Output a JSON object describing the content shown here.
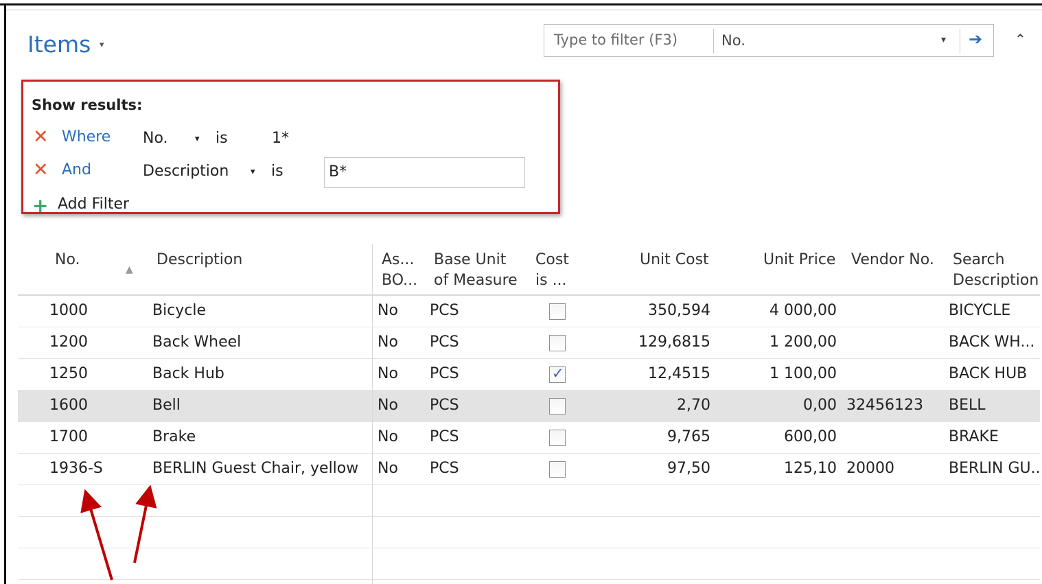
{
  "page": {
    "title": "Items",
    "title_caret": "▾",
    "collapse_icon": "⌃"
  },
  "filter_bar": {
    "placeholder": "Type to filter (F3)",
    "field": "No.",
    "dropdown_icon": "▾",
    "go_icon": "➔"
  },
  "show_results": {
    "title": "Show results:",
    "rows": [
      {
        "remove_icon": "✕",
        "keyword": "Where",
        "field": "No.",
        "caret": "▾",
        "operator": "is",
        "value": "1*"
      },
      {
        "remove_icon": "✕",
        "keyword": "And",
        "field": "Description",
        "caret": "▾",
        "operator": "is",
        "value": "B*"
      }
    ],
    "add_icon": "+",
    "add_label": "Add Filter"
  },
  "table": {
    "sort_icon": "▲",
    "headers": {
      "no": "No.",
      "description": "Description",
      "assembly_bom_1": "As...",
      "assembly_bom_2": "BO...",
      "base_unit_1": "Base Unit",
      "base_unit_2": "of Measure",
      "cost_1": "Cost",
      "cost_2": "is ...",
      "unit_cost": "Unit Cost",
      "unit_price": "Unit Price",
      "vendor_no": "Vendor No.",
      "search_1": "Search",
      "search_2": "Description"
    },
    "rows": [
      {
        "no": "1000",
        "description": "Bicycle",
        "bom": "No",
        "uom": "PCS",
        "cost_adjusted": false,
        "unit_cost": "350,594",
        "unit_price": "4 000,00",
        "vendor_no": "",
        "search": "BICYCLE"
      },
      {
        "no": "1200",
        "description": "Back Wheel",
        "bom": "No",
        "uom": "PCS",
        "cost_adjusted": false,
        "unit_cost": "129,6815",
        "unit_price": "1 200,00",
        "vendor_no": "",
        "search": "BACK WH..."
      },
      {
        "no": "1250",
        "description": "Back Hub",
        "bom": "No",
        "uom": "PCS",
        "cost_adjusted": true,
        "unit_cost": "12,4515",
        "unit_price": "1 100,00",
        "vendor_no": "",
        "search": "BACK HUB"
      },
      {
        "no": "1600",
        "description": "Bell",
        "bom": "No",
        "uom": "PCS",
        "cost_adjusted": false,
        "unit_cost": "2,70",
        "unit_price": "0,00",
        "vendor_no": "32456123",
        "search": "BELL"
      },
      {
        "no": "1700",
        "description": "Brake",
        "bom": "No",
        "uom": "PCS",
        "cost_adjusted": false,
        "unit_cost": "9,765",
        "unit_price": "600,00",
        "vendor_no": "",
        "search": "BRAKE"
      },
      {
        "no": "1936-S",
        "description": "BERLIN Guest Chair, yellow",
        "bom": "No",
        "uom": "PCS",
        "cost_adjusted": false,
        "unit_cost": "97,50",
        "unit_price": "125,10",
        "vendor_no": "20000",
        "search": "BERLIN GU..."
      }
    ]
  },
  "colors": {
    "accent": "#2a6fb8",
    "highlight_box": "#c9252c",
    "remove_icon": "#e0522d",
    "add_icon": "#3ea562",
    "selected_row": "#e3e3e3",
    "annotation_arrow": "#c00000"
  }
}
